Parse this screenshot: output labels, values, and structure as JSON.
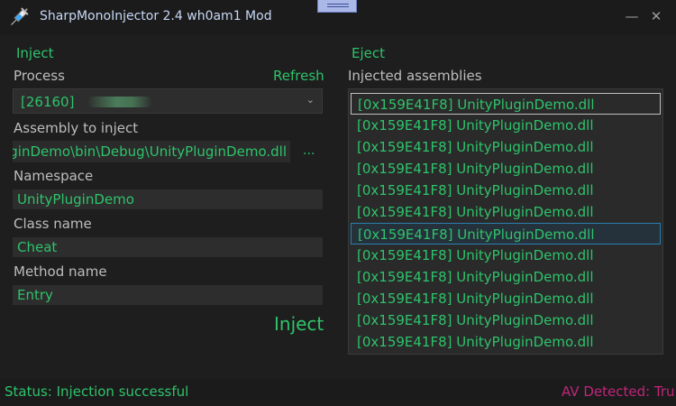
{
  "window": {
    "title": "SharpMonoInjector 2.4 wh0am1 Mod",
    "app_icon": "syringe-icon",
    "controls": [
      "minimize-icon",
      "close-icon"
    ]
  },
  "inject": {
    "section": "Inject",
    "process_label": "Process",
    "refresh": "Refresh",
    "process_value": "[26160]",
    "assembly_label": "Assembly to inject",
    "assembly_value": "ginDemo\\bin\\Debug\\UnityPluginDemo.dll",
    "browse": "...",
    "namespace_label": "Namespace",
    "namespace_value": "UnityPluginDemo",
    "class_label": "Class name",
    "class_value": "Cheat",
    "method_label": "Method name",
    "method_value": "Entry",
    "inject_button": "Inject"
  },
  "eject": {
    "section": "Eject",
    "list_label": "Injected assemblies",
    "items": [
      "[0x159E41F8] UnityPluginDemo.dll",
      "[0x159E41F8] UnityPluginDemo.dll",
      "[0x159E41F8] UnityPluginDemo.dll",
      "[0x159E41F8] UnityPluginDemo.dll",
      "[0x159E41F8] UnityPluginDemo.dll",
      "[0x159E41F8] UnityPluginDemo.dll",
      "[0x159E41F8] UnityPluginDemo.dll",
      "[0x159E41F8] UnityPluginDemo.dll",
      "[0x159E41F8] UnityPluginDemo.dll",
      "[0x159E41F8] UnityPluginDemo.dll",
      "[0x159E41F8] UnityPluginDemo.dll",
      "[0x159E41F8] UnityPluginDemo.dll"
    ]
  },
  "status": {
    "text": "Status:  Injection successful",
    "av": "AV Detected:  Tru"
  },
  "colors": {
    "accent": "#2ec36b",
    "av_warning": "#c0257a",
    "background": "#1e1e1e"
  }
}
